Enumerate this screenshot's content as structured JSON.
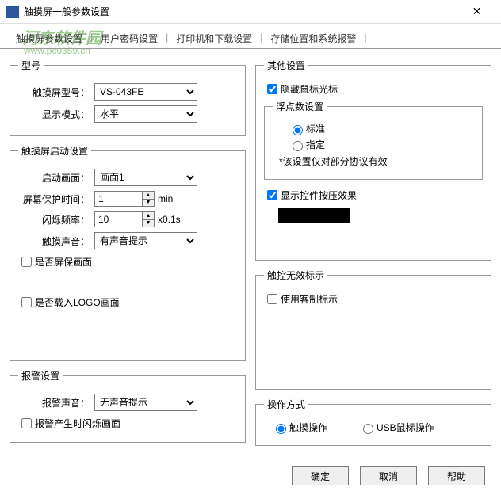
{
  "window": {
    "title": "触摸屏一般参数设置"
  },
  "watermark": {
    "main": "河东软件园",
    "sub": "www.pc0359.cn"
  },
  "tabs": {
    "t1": "触摸屏参数设置",
    "t2": "用户密码设置",
    "t3": "打印机和下载设置",
    "t4": "存储位置和系统报警"
  },
  "model": {
    "legend": "型号",
    "label_model": "触摸屏型号：",
    "value_model": "VS-043FE",
    "label_mode": "显示模式：",
    "value_mode": "水平"
  },
  "startup": {
    "legend": "触摸屏启动设置",
    "label_screen": "启动画面：",
    "value_screen": "画面1",
    "label_saver": "屏幕保护时间：",
    "value_saver": "1",
    "unit_saver": "min",
    "label_flash": "闪烁频率：",
    "value_flash": "10",
    "unit_flash": "x0.1s",
    "label_sound": "触摸声音：",
    "value_sound": "有声音提示",
    "chk_saver": "是否屏保画面",
    "chk_logo": "是否载入LOGO画面"
  },
  "alarm": {
    "legend": "报警设置",
    "label_sound": "报警声音：",
    "value_sound": "无声音提示",
    "chk_flash": "报警产生时闪烁画面"
  },
  "other": {
    "legend": "其他设置",
    "chk_hide_cursor": "隐藏鼠标光标",
    "float_legend": "浮点数设置",
    "radio_std": "标准",
    "radio_spec": "指定",
    "note": "*该设置仅对部分协议有效",
    "chk_press_effect": "显示控件按压效果"
  },
  "touch_invalid": {
    "legend": "触控无效标示",
    "chk_custom": "使用客制标示"
  },
  "operation": {
    "legend": "操作方式",
    "radio_touch": "触摸操作",
    "radio_usb": "USB鼠标操作"
  },
  "footer": {
    "ok": "确定",
    "cancel": "取消",
    "help": "帮助"
  }
}
